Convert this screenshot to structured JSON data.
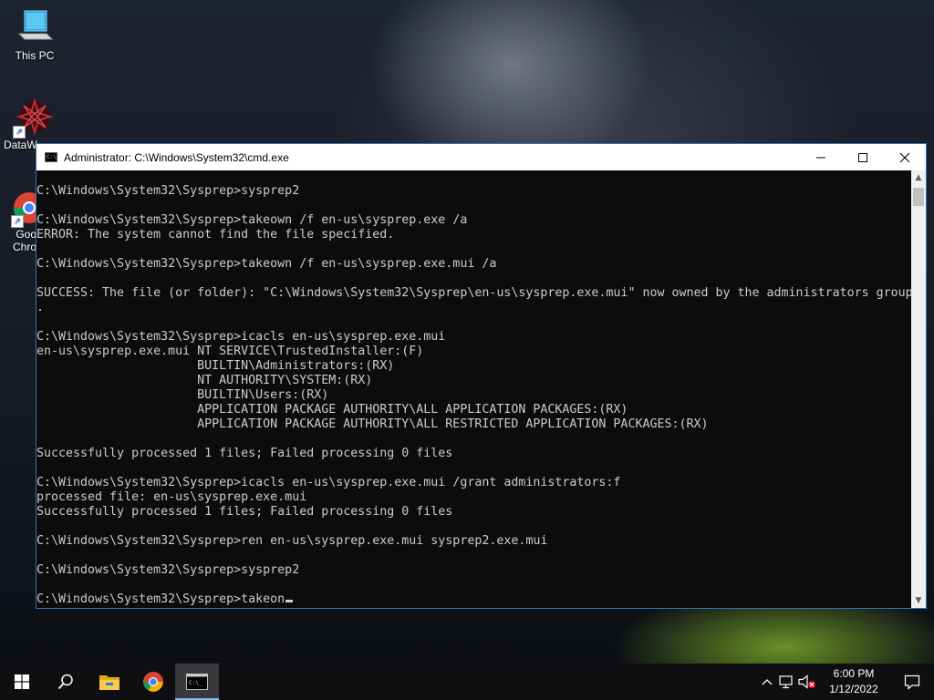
{
  "desktop": {
    "icons": [
      {
        "label": "This PC",
        "icon": "this-pc-icon"
      },
      {
        "label": "DataW",
        "icon": "datawrapper-icon"
      },
      {
        "label": "Goo Chro",
        "icon": "chrome-icon"
      }
    ]
  },
  "window": {
    "title": "Administrator: C:\\Windows\\System32\\cmd.exe",
    "controls": [
      "minimize",
      "maximize",
      "close"
    ],
    "lines": [
      "C:\\Windows\\System32\\Sysprep>sysprep2",
      "",
      "C:\\Windows\\System32\\Sysprep>takeown /f en-us\\sysprep.exe /a",
      "ERROR: The system cannot find the file specified.",
      "",
      "C:\\Windows\\System32\\Sysprep>takeown /f en-us\\sysprep.exe.mui /a",
      "",
      "SUCCESS: The file (or folder): \"C:\\Windows\\System32\\Sysprep\\en-us\\sysprep.exe.mui\" now owned by the administrators group",
      ".",
      "",
      "C:\\Windows\\System32\\Sysprep>icacls en-us\\sysprep.exe.mui",
      "en-us\\sysprep.exe.mui NT SERVICE\\TrustedInstaller:(F)",
      "                      BUILTIN\\Administrators:(RX)",
      "                      NT AUTHORITY\\SYSTEM:(RX)",
      "                      BUILTIN\\Users:(RX)",
      "                      APPLICATION PACKAGE AUTHORITY\\ALL APPLICATION PACKAGES:(RX)",
      "                      APPLICATION PACKAGE AUTHORITY\\ALL RESTRICTED APPLICATION PACKAGES:(RX)",
      "",
      "Successfully processed 1 files; Failed processing 0 files",
      "",
      "C:\\Windows\\System32\\Sysprep>icacls en-us\\sysprep.exe.mui /grant administrators:f",
      "processed file: en-us\\sysprep.exe.mui",
      "Successfully processed 1 files; Failed processing 0 files",
      "",
      "C:\\Windows\\System32\\Sysprep>ren en-us\\sysprep.exe.mui sysprep2.exe.mui",
      "",
      "C:\\Windows\\System32\\Sysprep>sysprep2",
      ""
    ],
    "current_input": "C:\\Windows\\System32\\Sysprep>takeon"
  },
  "taskbar": {
    "items": [
      "start-icon",
      "search-icon",
      "file-explorer-icon",
      "chrome-icon",
      "cmd-icon"
    ],
    "active": "cmd-icon",
    "tray": {
      "time": "6:00 PM",
      "date": "1/12/2022"
    }
  },
  "colors": {
    "console_bg": "#0c0c0c",
    "console_text": "#cccccc",
    "taskbar_bg": "#0f0f11",
    "accent": "#76b9ed"
  }
}
